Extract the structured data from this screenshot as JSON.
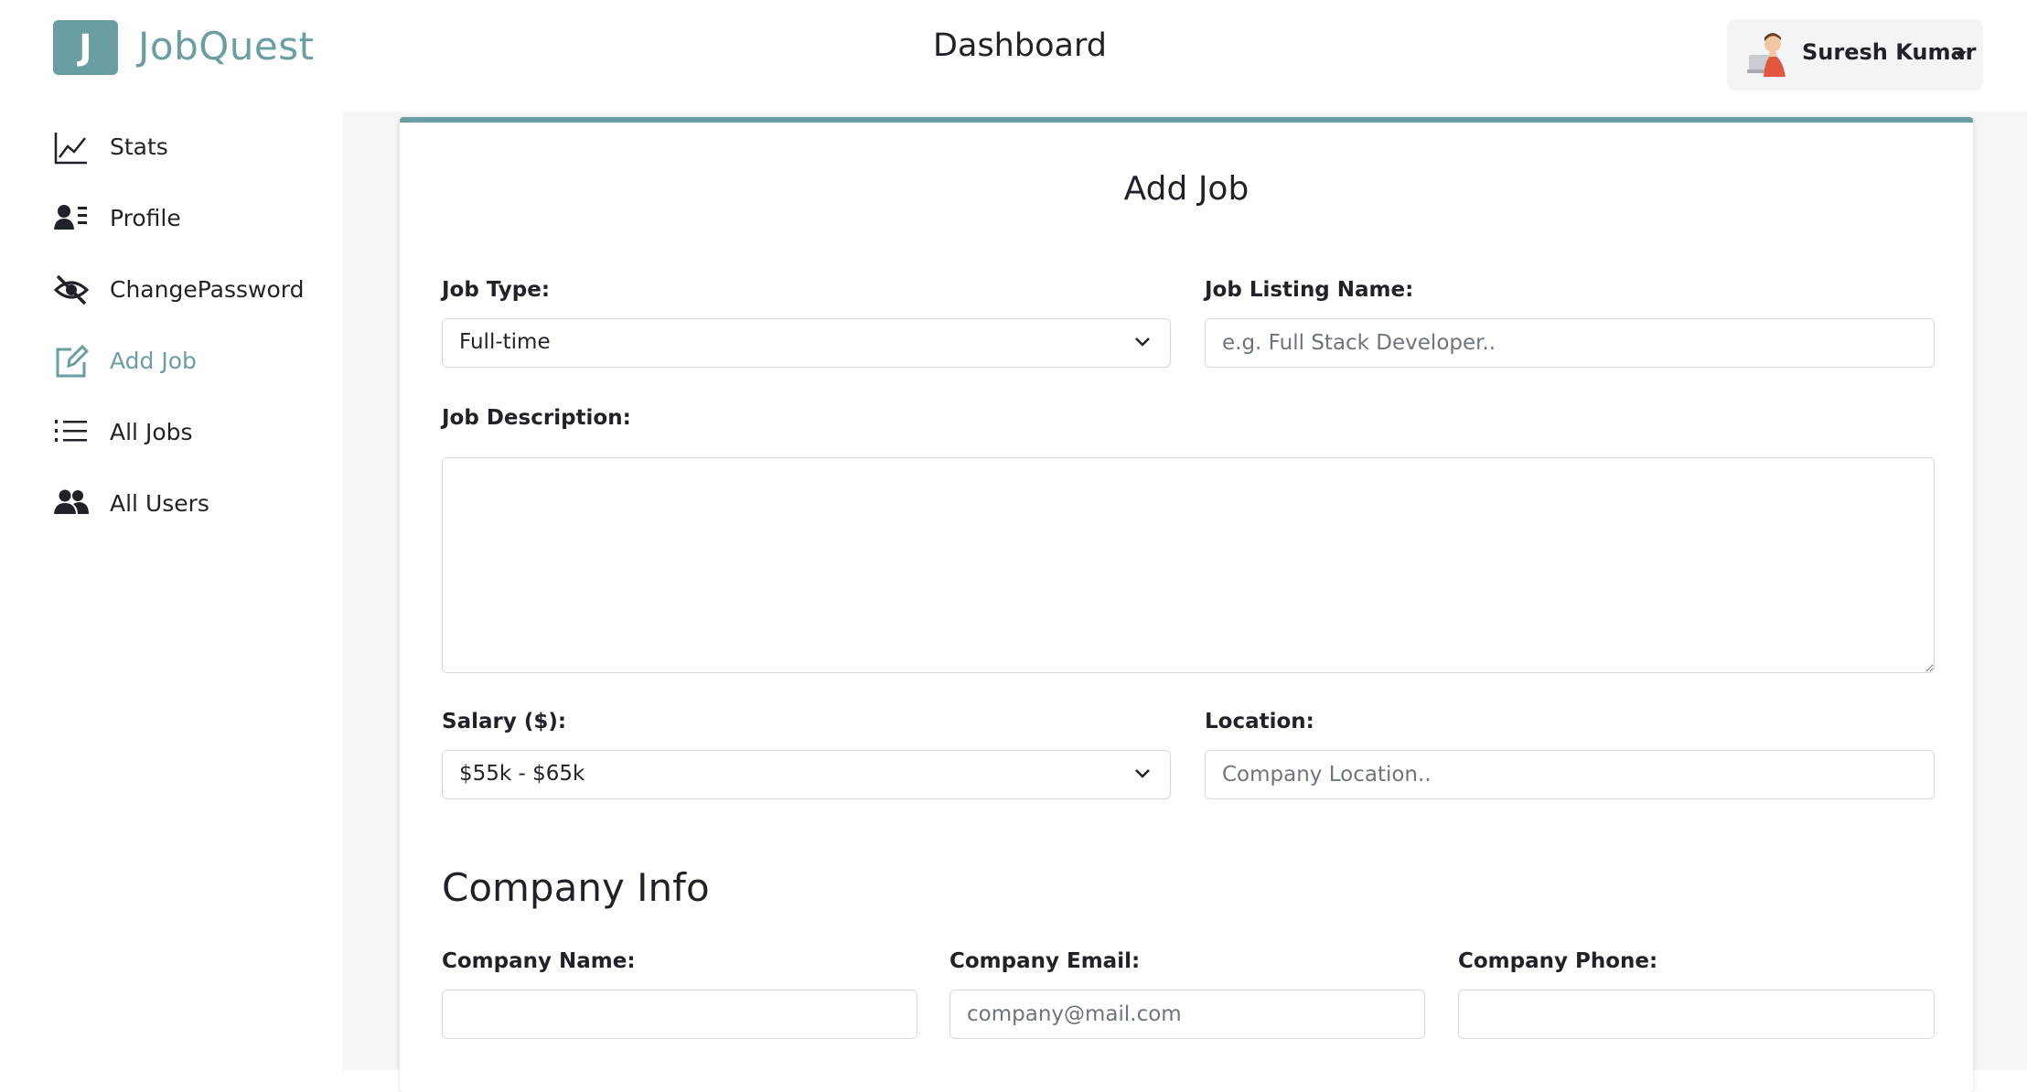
{
  "brand": {
    "logo_letter": "J",
    "name": "JobQuest"
  },
  "header": {
    "title": "Dashboard",
    "user_name": "Suresh Kumar"
  },
  "sidebar": {
    "items": [
      {
        "label": "Stats",
        "icon": "chart-line-icon",
        "active": false
      },
      {
        "label": "Profile",
        "icon": "profile-card-icon",
        "active": false
      },
      {
        "label": "ChangePassword",
        "icon": "eye-slash-icon",
        "active": false
      },
      {
        "label": "Add Job",
        "icon": "edit-icon",
        "active": true
      },
      {
        "label": "All Jobs",
        "icon": "list-icon",
        "active": false
      },
      {
        "label": "All Users",
        "icon": "users-icon",
        "active": false
      }
    ]
  },
  "form": {
    "title": "Add Job",
    "job_type": {
      "label": "Job Type:",
      "value": "Full-time"
    },
    "job_listing_name": {
      "label": "Job Listing Name:",
      "value": "",
      "placeholder": "e.g. Full Stack Developer.."
    },
    "job_description": {
      "label": "Job Description:",
      "value": ""
    },
    "salary": {
      "label": "Salary ($):",
      "value": "$55k - $65k"
    },
    "location": {
      "label": "Location:",
      "value": "",
      "placeholder": "Company Location.."
    },
    "company_section_title": "Company Info",
    "company_name": {
      "label": "Company Name:",
      "value": ""
    },
    "company_email": {
      "label": "Company Email:",
      "value": "",
      "placeholder": "company@mail.com"
    },
    "company_phone": {
      "label": "Company Phone:",
      "value": ""
    }
  },
  "colors": {
    "accent": "#6b9ea3",
    "main_bg": "#f4f5f6",
    "text": "#1f2329"
  }
}
